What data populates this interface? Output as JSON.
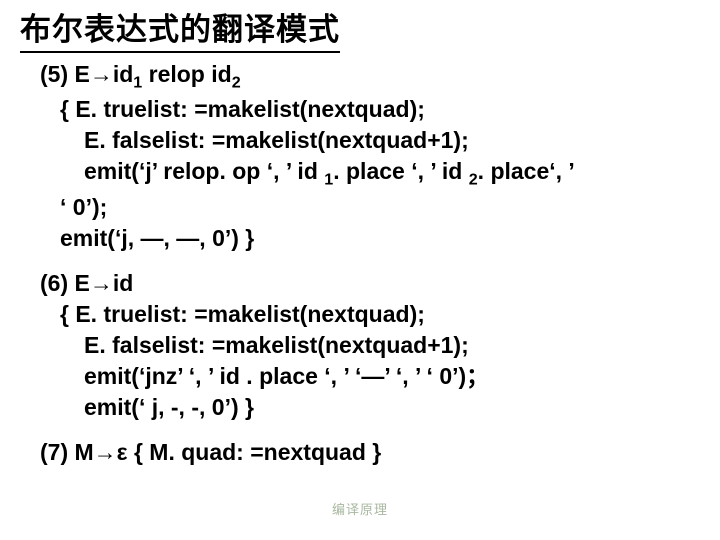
{
  "title": "布尔表达式的翻译模式",
  "rules": [
    {
      "head": "(5) E→id<sub>1</sub> relop id<sub>2</sub>",
      "lines": [
        "{ E. truelist: =makelist(nextquad);",
        "E. falselist: =makelist(nextquad+1);",
        "emit(‘j’ relop. op ‘, ’ id <sub>1</sub>. place ‘, ’ id <sub>2</sub>. place‘, ’",
        "‘ 0’);",
        "emit(‘j, —, —, 0’) }"
      ]
    },
    {
      "head": "(6) E→id",
      "lines": [
        "{ E. truelist: =makelist(nextquad);",
        "E. falselist: =makelist(nextquad+1);",
        "emit(‘jnz’ ‘, ’ id . place ‘, ’ ‘—’ ‘, ’   ‘ 0’)；",
        "emit(‘ j, -, -, 0’) }"
      ]
    },
    {
      "head": "(7) M→ε  { M. quad: =nextquad }",
      "lines": []
    }
  ],
  "footer": "编译原理"
}
